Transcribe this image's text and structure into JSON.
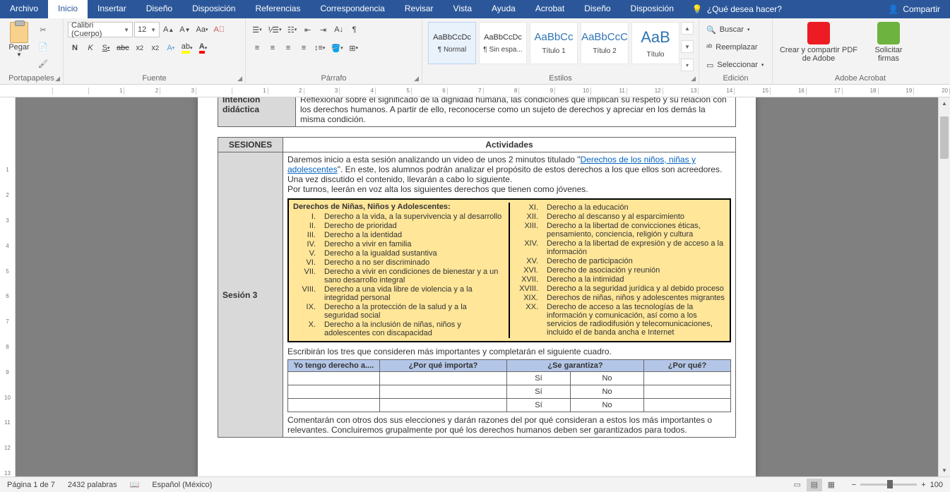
{
  "menubar": {
    "file": "Archivo",
    "home": "Inicio",
    "insert": "Insertar",
    "design": "Diseño",
    "layout": "Disposición",
    "references": "Referencias",
    "mailings": "Correspondencia",
    "review": "Revisar",
    "view": "Vista",
    "help": "Ayuda",
    "acrobat": "Acrobat",
    "design2": "Diseño",
    "layout2": "Disposición",
    "tellme": "¿Qué desea hacer?",
    "share": "Compartir"
  },
  "ribbon": {
    "clipboard": {
      "paste": "Pegar",
      "label": "Portapapeles"
    },
    "font": {
      "name": "Calibri (Cuerpo)",
      "size": "12",
      "label": "Fuente"
    },
    "paragraph": {
      "label": "Párrafo"
    },
    "styles": {
      "label": "Estilos",
      "tiles": [
        {
          "preview": "AaBbCcDc",
          "name": "¶ Normal"
        },
        {
          "preview": "AaBbCcDc",
          "name": "¶ Sin espa..."
        },
        {
          "preview": "AaBbCc",
          "name": "Título 1"
        },
        {
          "preview": "AaBbCcC",
          "name": "Título 2"
        },
        {
          "preview": "AaB",
          "name": "Título"
        }
      ]
    },
    "editing": {
      "find": "Buscar",
      "replace": "Reemplazar",
      "select": "Seleccionar",
      "label": "Edición"
    },
    "adobe": {
      "btn1": "Crear y compartir PDF de Adobe",
      "btn2": "Solicitar firmas",
      "label": "Adobe Acrobat"
    }
  },
  "ruler_marks": [
    "",
    "",
    "1",
    "2",
    "3",
    "",
    "1",
    "2",
    "3",
    "4",
    "5",
    "6",
    "7",
    "8",
    "9",
    "10",
    "11",
    "12",
    "13",
    "14",
    "15",
    "16",
    "17",
    "18",
    "19",
    "20"
  ],
  "ruler_v": [
    "",
    "",
    "1",
    "2",
    "3",
    "4",
    "5",
    "6",
    "7",
    "8",
    "9",
    "10",
    "11",
    "12",
    "13"
  ],
  "doc": {
    "intencion_label": "Intención didáctica",
    "intencion_text": "Reflexionar sobre el significado de la dignidad humana, las condiciones que implican su respeto y su relación con los derechos humanos. A partir de ello, reconocerse como un sujeto de derechos y apreciar en los demás la misma condición.",
    "ses_header": "SESIONES",
    "act_header": "Actividades",
    "ses_label": "Sesión 3",
    "intro1a": "Daremos inicio a esta sesión analizando un video de unos 2 minutos titulado \"",
    "intro1_link": "Derechos de los niños, niñas y adolescentes",
    "intro1b": "\". En este, los alumnos podrán analizar el propósito de estos derechos a los que ellos son acreedores. Una vez discutido el contenido, llevarán a cabo lo siguiente.",
    "intro2": "Por turnos, leerán en voz alta los siguientes derechos que tienen como jóvenes.",
    "rights_title": "Derechos de Niñas, Niños y Adolescentes:",
    "rights_left": [
      {
        "n": "I.",
        "t": "Derecho a la vida, a la supervivencia y al desarrollo"
      },
      {
        "n": "II.",
        "t": "Derecho de prioridad"
      },
      {
        "n": "III.",
        "t": "Derecho a la identidad"
      },
      {
        "n": "IV.",
        "t": "Derecho a vivir en familia"
      },
      {
        "n": "V.",
        "t": "Derecho a la igualdad sustantiva"
      },
      {
        "n": "VI.",
        "t": "Derecho a no ser discriminado"
      },
      {
        "n": "VII.",
        "t": "Derecho a vivir en condiciones de bienestar y a un sano desarrollo integral"
      },
      {
        "n": "VIII.",
        "t": "Derecho a una vida libre de violencia y a la integridad personal"
      },
      {
        "n": "IX.",
        "t": "Derecho a la protección de la salud y a la seguridad social"
      },
      {
        "n": "X.",
        "t": "Derecho a la inclusión de niñas, niños y adolescentes con discapacidad"
      }
    ],
    "rights_right": [
      {
        "n": "XI.",
        "t": "Derecho a la educación"
      },
      {
        "n": "XII.",
        "t": "Derecho al descanso y al esparcimiento"
      },
      {
        "n": "XIII.",
        "t": "Derecho a la libertad de convicciones éticas, pensamiento, conciencia, religión y cultura"
      },
      {
        "n": "XIV.",
        "t": "Derecho a la libertad de expresión y de acceso a la información"
      },
      {
        "n": "XV.",
        "t": "Derecho de participación"
      },
      {
        "n": "XVI.",
        "t": "Derecho de asociación y reunión"
      },
      {
        "n": "XVII.",
        "t": "Derecho a la intimidad"
      },
      {
        "n": "XVIII.",
        "t": "Derecho a la seguridad jurídica y al debido proceso"
      },
      {
        "n": "XIX.",
        "t": "Derechos de niñas, niños y adolescentes migrantes"
      },
      {
        "n": "XX.",
        "t": "Derecho de acceso a las tecnologías de la información y comunicación, así como a los servicios de radiodifusión y telecomunicaciones, incluido el de banda ancha e Internet"
      }
    ],
    "task": "Escribirán los tres que consideren más importantes y completarán el siguiente cuadro.",
    "subtbl": {
      "h1": "Yo tengo derecho a....",
      "h2": "¿Por qué importa?",
      "h3": "¿Se garantiza?",
      "h4": "¿Por qué?",
      "si": "Sí",
      "no": "No"
    },
    "outro": "Comentarán con otros dos sus elecciones y darán razones del por qué consideran a estos los más importantes o relevantes. Concluiremos grupalmente por qué los derechos humanos deben ser garantizados para todos."
  },
  "status": {
    "page": "Página 1 de 7",
    "words": "2432 palabras",
    "lang": "Español (México)",
    "zoom": "100"
  }
}
